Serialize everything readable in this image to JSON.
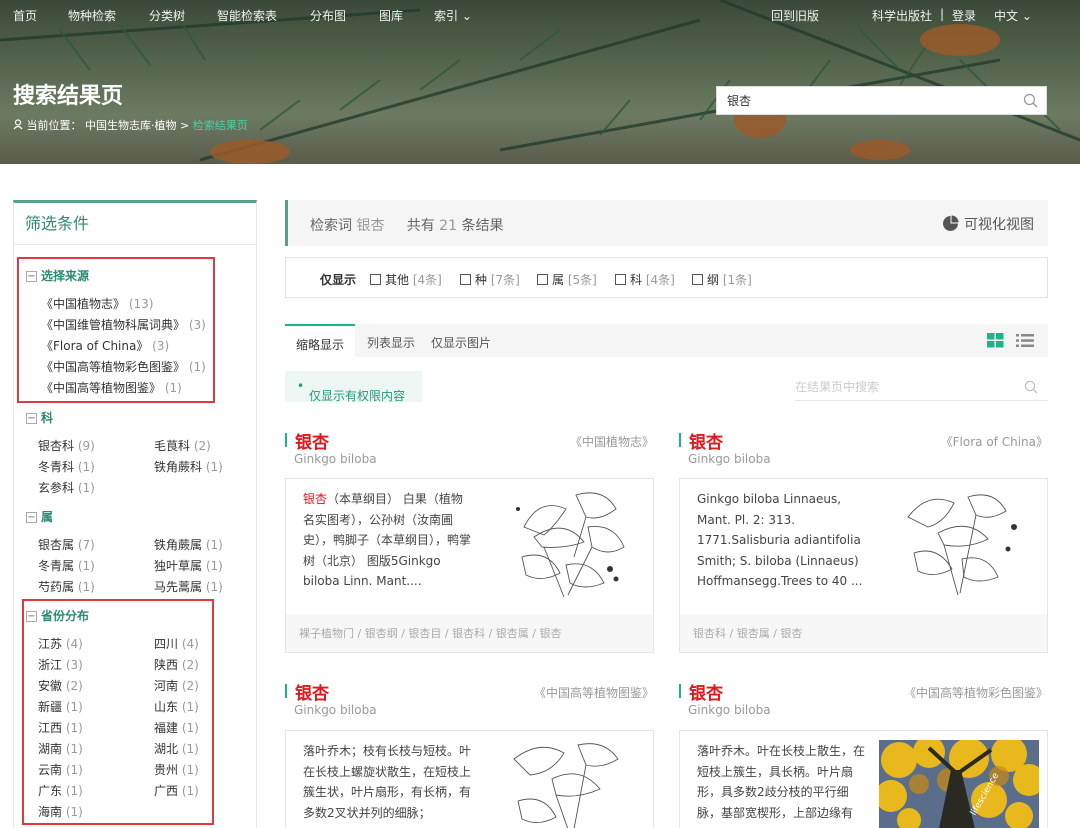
{
  "topnav": {
    "items": [
      "首页",
      "物种检索",
      "分类树",
      "智能检索表",
      "分布图",
      "图库",
      "索引"
    ],
    "old_version": "回到旧版",
    "publisher": "科学出版社",
    "divider": "|",
    "login": "登录",
    "language": "中文"
  },
  "hero": {
    "title": "搜索结果页",
    "breadcrumb_label": "当前位置：",
    "breadcrumb_home": "中国生物志库·植物",
    "breadcrumb_sep": ">",
    "breadcrumb_current": "检索结果页",
    "search_value": "银杏"
  },
  "sidebar": {
    "title": "筛选条件",
    "source": {
      "heading": "选择来源",
      "items": [
        {
          "label": "《中国植物志》",
          "count": "(13)"
        },
        {
          "label": "《中国维管植物科属词典》",
          "count": "(3)"
        },
        {
          "label": "《Flora of China》",
          "count": "(3)"
        },
        {
          "label": "《中国高等植物彩色图鉴》",
          "count": "(1)"
        },
        {
          "label": "《中国高等植物图鉴》",
          "count": "(1)"
        }
      ]
    },
    "family": {
      "heading": "科",
      "items": [
        {
          "label": "银杏科",
          "count": "(9)"
        },
        {
          "label": "毛茛科",
          "count": "(2)"
        },
        {
          "label": "冬青科",
          "count": "(1)"
        },
        {
          "label": "铁角蕨科",
          "count": "(1)"
        },
        {
          "label": "玄参科",
          "count": "(1)"
        }
      ]
    },
    "genus": {
      "heading": "属",
      "items": [
        {
          "label": "银杏属",
          "count": "(7)"
        },
        {
          "label": "铁角蕨属",
          "count": "(1)"
        },
        {
          "label": "冬青属",
          "count": "(1)"
        },
        {
          "label": "独叶草属",
          "count": "(1)"
        },
        {
          "label": "芍药属",
          "count": "(1)"
        },
        {
          "label": "马先蒿属",
          "count": "(1)"
        }
      ]
    },
    "province": {
      "heading": "省份分布",
      "items": [
        {
          "label": "江苏",
          "count": "(4)"
        },
        {
          "label": "四川",
          "count": "(4)"
        },
        {
          "label": "浙江",
          "count": "(3)"
        },
        {
          "label": "陕西",
          "count": "(2)"
        },
        {
          "label": "安徽",
          "count": "(2)"
        },
        {
          "label": "河南",
          "count": "(2)"
        },
        {
          "label": "新疆",
          "count": "(1)"
        },
        {
          "label": "山东",
          "count": "(1)"
        },
        {
          "label": "江西",
          "count": "(1)"
        },
        {
          "label": "福建",
          "count": "(1)"
        },
        {
          "label": "湖南",
          "count": "(1)"
        },
        {
          "label": "湖北",
          "count": "(1)"
        },
        {
          "label": "云南",
          "count": "(1)"
        },
        {
          "label": "贵州",
          "count": "(1)"
        },
        {
          "label": "广东",
          "count": "(1)"
        },
        {
          "label": "广西",
          "count": "(1)"
        },
        {
          "label": "海南",
          "count": "(1)"
        }
      ]
    }
  },
  "summary": {
    "keyword_label": "检索词",
    "keyword": "银杏",
    "total_prefix": "共有",
    "total": "21",
    "total_suffix": "条结果",
    "visualize": "可视化视图"
  },
  "filter": {
    "label": "仅显示",
    "options": [
      {
        "label": "其他",
        "count": "[4条]"
      },
      {
        "label": "种",
        "count": "[7条]"
      },
      {
        "label": "属",
        "count": "[5条]"
      },
      {
        "label": "科",
        "count": "[4条]"
      },
      {
        "label": "纲",
        "count": "[1条]"
      }
    ]
  },
  "tabs": {
    "items": [
      "缩略显示",
      "列表显示",
      "仅显示图片"
    ]
  },
  "permission_only": "仅显示有权限内容",
  "inpage_search_placeholder": "在结果页中搜索",
  "accent_color": "#1cb58b",
  "highlight_color": "#e1181c",
  "cards": [
    {
      "name": "银杏",
      "latin": "Ginkgo biloba",
      "source": "《中国植物志》",
      "desc_highlight": "银杏",
      "desc": "（本草纲目） 白果（植物名实图考），公孙树（汝南圃史），鸭脚子（本草纲目），鸭掌树（北京） 图版5Ginkgo biloba Linn. Mant....",
      "path": "裸子植物门 / 银杏纲 / 银杏目 / 银杏科 / 银杏属 / 银杏"
    },
    {
      "name": "银杏",
      "latin": "Ginkgo biloba",
      "source": "《Flora of China》",
      "desc_highlight": "",
      "desc": "Ginkgo biloba Linnaeus, Mant. Pl. 2: 313. 1771.Salisburia adiantifolia Smith; S. biloba (Linnaeus) Hoffmansegg.Trees to 40 ...",
      "path": "银杏科 / 银杏属 / 银杏"
    },
    {
      "name": "银杏",
      "latin": "Ginkgo biloba",
      "source": "《中国高等植物图鉴》",
      "desc_highlight": "",
      "desc": "落叶乔木；枝有长枝与短枝。叶在长枝上螺旋状散生，在短枝上簇生状，叶片扇形，有长柄，有多数2叉状并列的细脉；",
      "path": ""
    },
    {
      "name": "银杏",
      "latin": "Ginkgo biloba",
      "source": "《中国高等植物彩色图鉴》",
      "desc_highlight": "",
      "desc": "落叶乔木。叶在长枝上散生，在短枝上簇生，具长柄。叶片扇形，具多数2歧分枝的平行细脉，基部宽楔形，上部边缘有",
      "path": "",
      "photo_caption": "lifescience"
    }
  ]
}
